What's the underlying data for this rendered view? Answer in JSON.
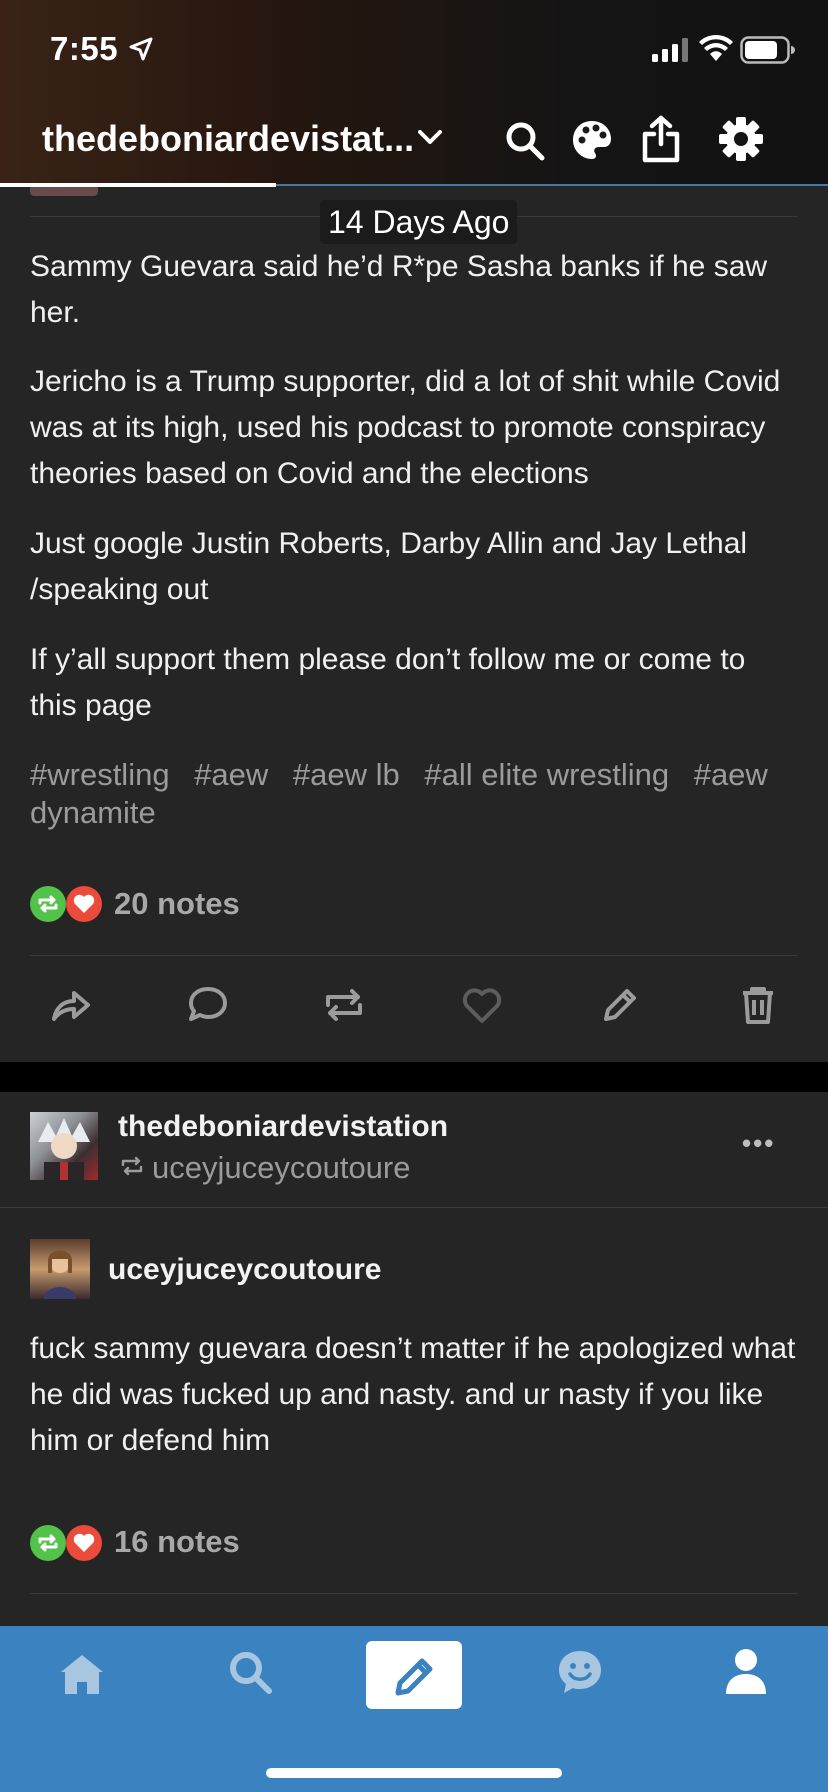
{
  "status_bar": {
    "time": "7:55"
  },
  "header": {
    "blog_title": "thedeboniardevistat...",
    "icons": [
      "chevron-down-icon",
      "search-icon",
      "palette-icon",
      "share-icon",
      "gear-icon"
    ]
  },
  "post1": {
    "timestamp": "14 Days Ago",
    "paragraphs": [
      "Sammy Guevara said he’d R*pe Sasha banks if he saw her.",
      "Jericho is a Trump supporter, did a lot of shit while Covid was at its high, used his podcast to promote conspiracy theories based on Covid and the elections",
      "Just google Justin Roberts, Darby Allin and Jay Lethal /speaking out",
      "If y’all support them please don’t follow me or come to this page"
    ],
    "tags": [
      "#wrestling",
      "#aew",
      "#aew lb",
      "#all elite wrestling",
      "#aew dynamite"
    ],
    "notes": "20 notes",
    "actions": [
      "share-icon",
      "reply-icon",
      "reblog-icon",
      "like-icon",
      "edit-icon",
      "delete-icon"
    ]
  },
  "post2": {
    "blog_name": "thedeboniardevistation",
    "reblogged_from": "uceyjuceycoutoure",
    "original_author": "uceyjuceycoutoure",
    "body": "fuck sammy guevara doesn’t matter if he apologized what he did was fucked up and nasty. and ur nasty if you like him or defend him",
    "notes": "16 notes",
    "more_label": "•••"
  },
  "bottom_nav": {
    "items": [
      "home-icon",
      "search-icon",
      "compose-icon",
      "activity-icon",
      "account-icon"
    ],
    "active": "compose-icon"
  },
  "colors": {
    "accent": "#3a83c0",
    "background": "#252525",
    "reblog_green": "#52c24a",
    "like_red": "#ec4b3b"
  }
}
